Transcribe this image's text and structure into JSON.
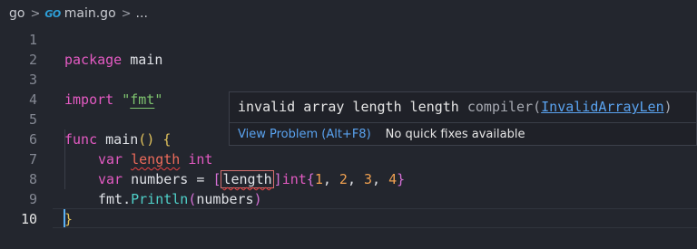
{
  "breadcrumb": {
    "folder": "go",
    "file_icon": "go-file-icon",
    "file": "main.go",
    "ellipsis": "..."
  },
  "editor": {
    "line_numbers": [
      "1",
      "2",
      "3",
      "4",
      "5",
      "6",
      "7",
      "8",
      "9",
      "10"
    ],
    "active_line": "10",
    "lines": {
      "l1": [
        "package",
        " main"
      ],
      "l3": [
        "import",
        " ",
        "\"",
        "fmt",
        "\""
      ],
      "l5": [
        "func",
        " main",
        "(",
        ")",
        " ",
        "{"
      ],
      "l6": [
        "var",
        " ",
        "length",
        " ",
        "int"
      ],
      "l7": [
        "var",
        " numbers = ",
        "[",
        "length",
        "]",
        "int",
        "{",
        "1",
        ", ",
        "2",
        ", ",
        "3",
        ", ",
        "4",
        "}"
      ],
      "l8": [
        "fmt.",
        "Println",
        "(",
        "numbers",
        ")"
      ],
      "l9": [
        "}"
      ]
    }
  },
  "hover": {
    "message": "invalid array length length",
    "source": " compiler(",
    "code": "InvalidArrayLen",
    "source_close": ")",
    "view_problem": "View Problem (Alt+F8)",
    "no_quick_fixes": "No quick fixes available"
  }
}
